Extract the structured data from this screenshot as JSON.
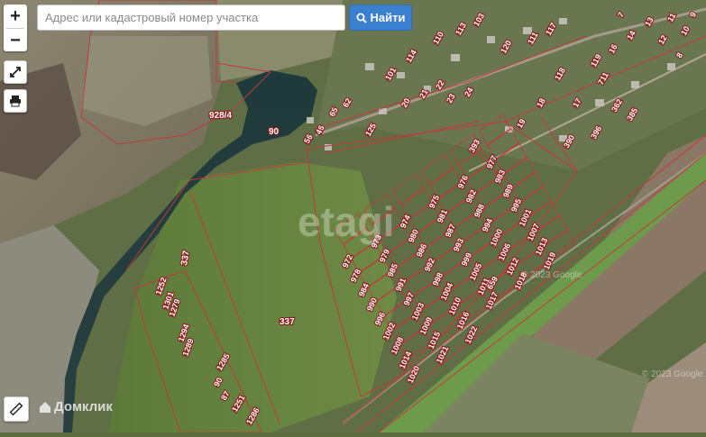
{
  "search": {
    "placeholder": "Адрес или кадастровый номер участка",
    "button_label": "Найти"
  },
  "controls": {
    "zoom_in": "+",
    "zoom_out": "−"
  },
  "branding": {
    "logo_text": "Домклик",
    "watermark_center": "etagi",
    "copyright": "© 2023 Google"
  },
  "colors": {
    "parcel_border": "#c23a3a",
    "button_blue": "#3a7fd0"
  },
  "plots": {
    "labels": [
      "928/4",
      "90",
      "337",
      "337",
      "1252",
      "1301",
      "1279",
      "1294",
      "1289",
      "1285",
      "90",
      "87",
      "1251",
      "1286",
      "972",
      "973",
      "974",
      "975",
      "976",
      "977",
      "978",
      "979",
      "980",
      "981",
      "982",
      "983",
      "984",
      "985",
      "986",
      "987",
      "988",
      "989",
      "990",
      "991",
      "992",
      "993",
      "994",
      "995",
      "996",
      "997",
      "998",
      "999",
      "1000",
      "1001",
      "1002",
      "1003",
      "1004",
      "1005",
      "1006",
      "1007",
      "1008",
      "1009",
      "1010",
      "1011",
      "1012",
      "1013",
      "1014",
      "1015",
      "1016",
      "1017",
      "1018",
      "1019",
      "1020",
      "1021",
      "1022",
      "359",
      "26",
      "96",
      "65",
      "62",
      "125",
      "101",
      "114",
      "110",
      "113",
      "103",
      "120",
      "111",
      "117",
      "118",
      "119",
      "711",
      "390",
      "396",
      "362",
      "385",
      "393",
      "24",
      "23",
      "22",
      "21",
      "20",
      "19",
      "18",
      "17",
      "16",
      "14",
      "13",
      "12",
      "11",
      "10",
      "9",
      "8",
      "7",
      "6",
      "5",
      "4"
    ]
  }
}
